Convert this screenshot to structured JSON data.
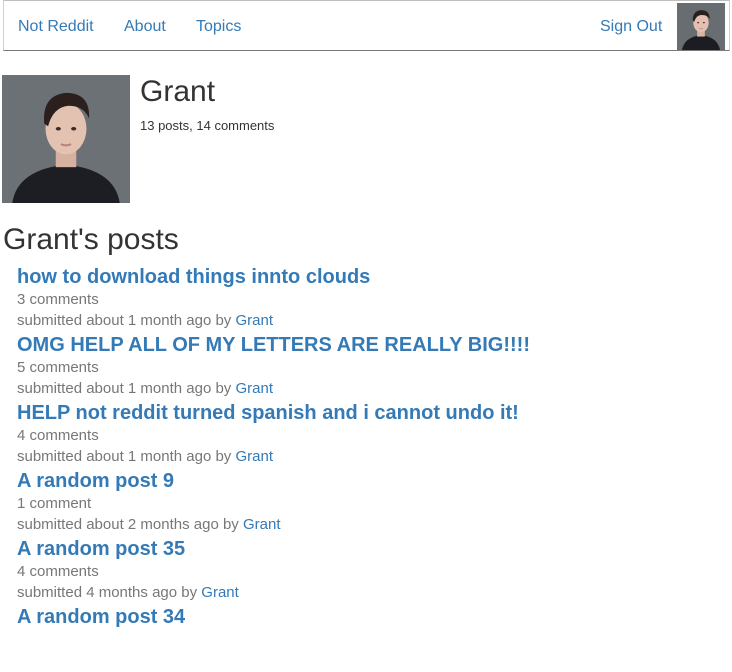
{
  "navbar": {
    "brand": "Not Reddit",
    "about": "About",
    "topics": "Topics",
    "sign_out": "Sign Out"
  },
  "profile": {
    "name": "Grant",
    "stats": "13 posts, 14 comments"
  },
  "posts_heading": "Grant's posts",
  "posts": [
    {
      "title": "how to download things innto clouds",
      "comments": "3 comments",
      "submitted": "submitted about 1 month ago by",
      "author": "Grant"
    },
    {
      "title": "OMG HELP ALL OF MY LETTERS ARE REALLY BIG!!!!",
      "comments": "5 comments",
      "submitted": "submitted about 1 month ago by",
      "author": "Grant"
    },
    {
      "title": "HELP not reddit turned spanish and i cannot undo it!",
      "comments": "4 comments",
      "submitted": "submitted about 1 month ago by",
      "author": "Grant"
    },
    {
      "title": "A random post 9",
      "comments": "1 comment",
      "submitted": "submitted about 2 months ago by",
      "author": "Grant"
    },
    {
      "title": "A random post 35",
      "comments": "4 comments",
      "submitted": "submitted 4 months ago by",
      "author": "Grant"
    },
    {
      "title": "A random post 34",
      "comments": "",
      "submitted": "",
      "author": ""
    }
  ]
}
